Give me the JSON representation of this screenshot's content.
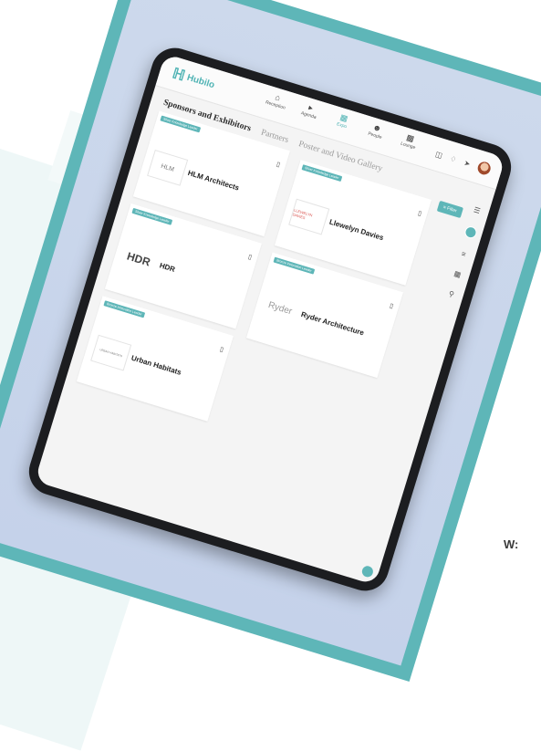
{
  "app": {
    "logo_text": "Hubilo"
  },
  "nav": [
    {
      "label": "Reception",
      "icon": "home-icon"
    },
    {
      "label": "Agenda",
      "icon": "video-icon"
    },
    {
      "label": "Expo",
      "icon": "expo-icon"
    },
    {
      "label": "People",
      "icon": "people-icon"
    },
    {
      "label": "Lounge",
      "icon": "lounge-icon"
    }
  ],
  "tabs": [
    {
      "label": "Sponsors and Exhibitors",
      "active": true
    },
    {
      "label": "Partners",
      "active": false
    },
    {
      "label": "Poster and Video Gallery",
      "active": false
    }
  ],
  "filter": {
    "label": "Filter"
  },
  "cards": [
    {
      "tag": "Silver Knowledge Leader",
      "name": "HLM Architects",
      "logo": "HLM"
    },
    {
      "tag": "Silver Knowledge Leader",
      "name": "Llewelyn Davies",
      "logo": "LLEWELYN DAVIES"
    },
    {
      "tag": "Silver Knowledge Leader",
      "name": "HDR",
      "logo": "HDR"
    },
    {
      "tag": "Bronze Innovation Leader",
      "name": "Ryder Architecture",
      "logo": "Ryder"
    },
    {
      "tag": "Bronze Innovation Leader",
      "name": "Urban Habitats",
      "logo": "URBAN HABITATS"
    }
  ],
  "caption": {
    "text": "W:"
  },
  "colors": {
    "accent": "#5eb6b8",
    "frame": "#5eb6b8",
    "frame_inner": "#c8d4eb",
    "device": "#1c1d20"
  }
}
